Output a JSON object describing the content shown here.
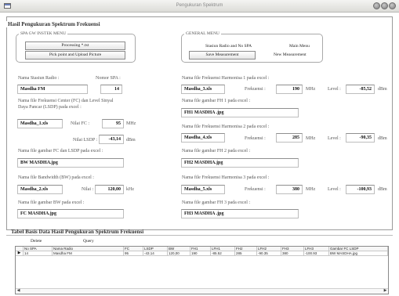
{
  "window": {
    "title": "Pengukuran Spektrum"
  },
  "panel": {
    "title": "Hasil Pengukuran Spektrum Frekuensi"
  },
  "spa_menu": {
    "label": "SPA GW INSTEK MENU",
    "processing_button": "Processing *.txt",
    "pick_button": "Pick point and Upload Picture"
  },
  "general_menu": {
    "label": "GENERAL MENU",
    "station_radio_button": "Stasiun Radio and No SPA",
    "main_menu_button": "Main Menu",
    "save_button": "Save Measurement",
    "new_button": "New Measurement"
  },
  "left_form": {
    "station_label": "Nama Stasiun Radio",
    "station_value": "Masdha FM",
    "spa_no_label": "Nomor SPA",
    "spa_no_value": "14",
    "fc_file_label_line1": "Nama file Frekuensi Center (FC) dan Level Sinyal",
    "fc_file_label_line2": "Daya Pancar (LSDP) pada excel",
    "fc_file_value": "Masdha_1.xls",
    "fc_label": "Nilai FC :",
    "fc_value": "95",
    "fc_unit": "MHz",
    "lsdp_label": "Nilai LSDP :",
    "lsdp_value": "-43,14",
    "lsdp_unit": "dBm",
    "fc_img_label": "Nama file gambar FC dan LSDP pada excel",
    "fc_img_value": "BW MASDHA.jpg",
    "bw_file_label": "Nama file Bandwidth (BW) pada excel",
    "bw_file_value": "Masdha_2.xls",
    "bw_label": "Nilai",
    "bw_value": "120,00",
    "bw_unit": "kHz",
    "bw_img_label": "Nama file gambar BW pada excel",
    "bw_img_value": "FC MASDHA.jpg"
  },
  "right_form": {
    "fh1_file_label": "Nama file Frekuensi Harmonisa 1 pada excel",
    "fh1_file_value": "Masdha_3.xls",
    "fh1_freq_label": "Frekuensi :",
    "fh1_freq_value": "190",
    "fh1_level_label": "Level :",
    "fh1_level_value": "-85,52",
    "fh1_img_label": "Nama file gambar FH 1 pada excel",
    "fh1_img_value": "FH1 MASDHA .jpg",
    "fh2_file_label": "Nama file Frekuensi Harmonisa 2 pada excel",
    "fh2_file_value": "Masdha_4.xls",
    "fh2_freq_label": "Frekuensi :",
    "fh2_freq_value": "285",
    "fh2_level_label": "Level :",
    "fh2_level_value": "-90,35",
    "fh2_img_label": "Nama file gambar FH 2 pada excel",
    "fh2_img_value": "FH2 MASDHA.jpg",
    "fh3_file_label": "Nama file Frekuensi Harmonisa 3 pada excel",
    "fh3_file_value": "Masdha_5.xls",
    "fh3_freq_label": "Frekuensi :",
    "fh3_freq_value": "380",
    "fh3_level_label": "Level :",
    "fh3_level_value": "-100,93",
    "fh3_img_label": "Nama file gambar FH 3 pada excel",
    "fh3_img_value": "FH3 MASDHA .jpg",
    "mhz_unit": "MHz",
    "dbm_unit": "dBm"
  },
  "database": {
    "title": "Tabel Basis Data Hasil Pengukuran Spektrum Frekuensi",
    "delete_button": "Delete",
    "query_button": "Query",
    "columns": [
      "No SPA",
      "Nama Radio",
      "FC",
      "LSDP",
      "BW",
      "FH1",
      "LFH1",
      "FH2",
      "LFH2",
      "FH3",
      "LFH3",
      "Gambar FC LSDP"
    ],
    "rows": [
      [
        "14",
        "Masdha FM",
        "95",
        "-43.14",
        "120,00",
        "190",
        "-85.52",
        "285",
        "-90.35",
        "380",
        "-100.93",
        "BW MASDHA.jpg"
      ]
    ],
    "current_row_icon": "triangle-right-icon",
    "scroll_left_icon": "chevron-left-icon",
    "scroll_right_icon": "chevron-right-icon"
  }
}
